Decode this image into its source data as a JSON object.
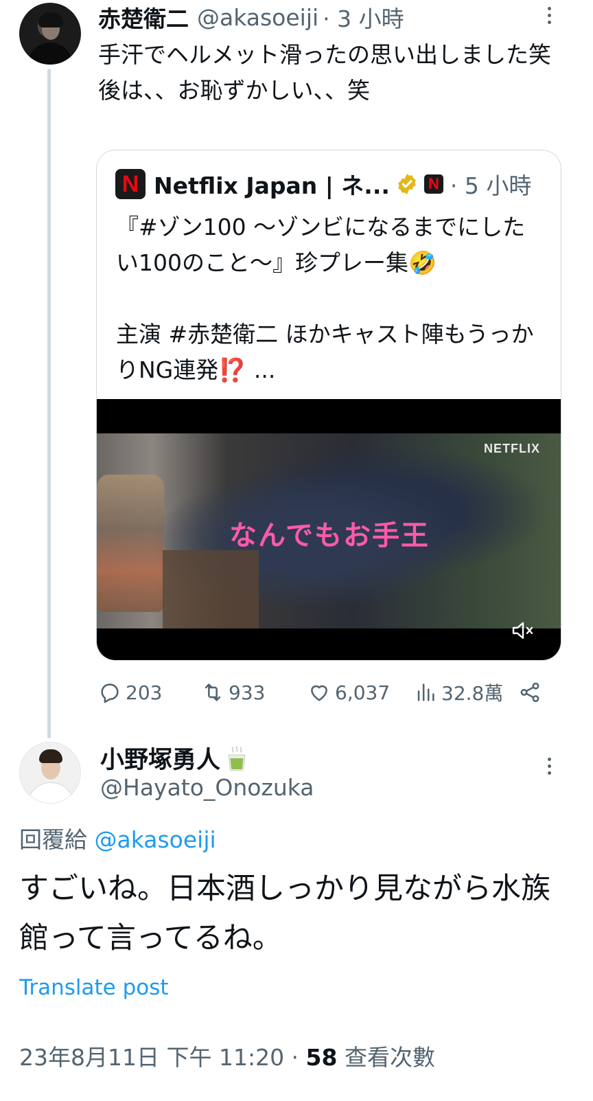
{
  "quoted_tweet": {
    "author_name": "赤楚衛二",
    "author_handle": "@akasoeiji",
    "time": "· 3 小時",
    "text": "手汗でヘルメット滑ったの思い出しました笑\n後は、、お恥ずかしい、、笑",
    "quote": {
      "logo_letter": "N",
      "author_name": "Netflix Japan | ネ...",
      "time": "· 5 小時",
      "text": "『#ゾン100 〜ゾンビになるまでにしたい100のこと〜』珍プレー集🤣\n\n主演 #赤楚衛二 ほかキャスト陣もうっかりNG連発⁉️ ...",
      "video": {
        "watermark": "NETFLIX",
        "caption": "なんでもお手王"
      }
    },
    "actions": {
      "replies": "203",
      "retweets": "933",
      "likes": "6,037",
      "views": "32.8萬"
    }
  },
  "reply_tweet": {
    "author_name": "小野塚勇人",
    "author_handle": "@Hayato_Onozuka",
    "reply_prefix": "回覆給",
    "reply_mention": "@akasoeiji",
    "text": "すごいね。日本酒しっかり見ながら水族館って言ってるね。",
    "translate_label": "Translate post",
    "timestamp": "23年8月11日 下午 11:20 · ",
    "view_count": "58",
    "view_label": " 查看次數"
  },
  "colors": {
    "link": "#1d9bf0",
    "muted": "#536471",
    "verified_gold": "#e2b719",
    "netflix_red": "#e50914"
  }
}
